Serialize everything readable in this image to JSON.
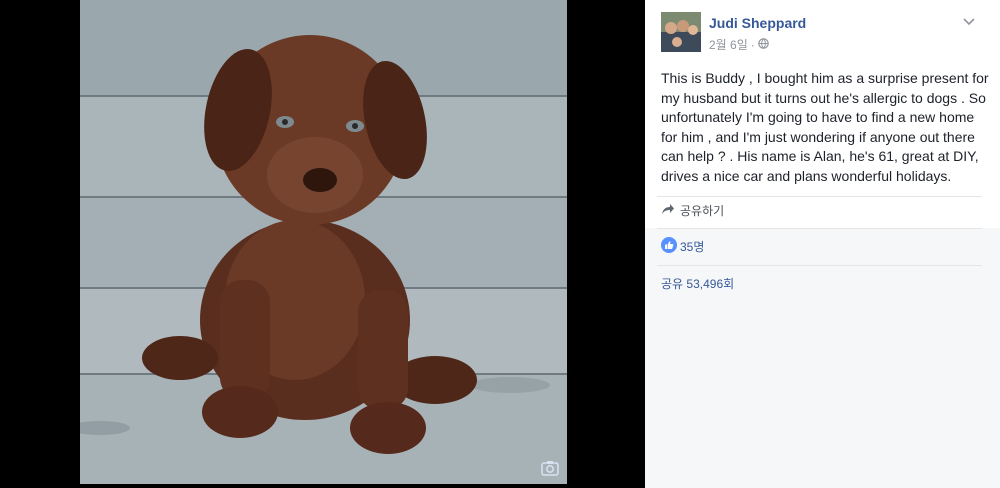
{
  "post": {
    "author": "Judi Sheppard",
    "timestamp": "2월 6일",
    "text": "This is Buddy , I bought him as a surprise present for my husband but it turns out he's allergic to dogs . So unfortunately I'm going to have to find a new home for him , and I'm just wondering if anyone out there can help ? . His name is Alan, he's 61, great at DIY, drives a nice car and plans wonderful holidays.",
    "share_label": "공유하기",
    "likes_count": "35명",
    "shares_count": "공유 53,496회"
  },
  "icons": {
    "camera": "camera-icon",
    "globe": "globe-icon",
    "chevron": "chevron-down-icon",
    "share": "share-arrow-icon",
    "like": "like-thumb-icon"
  },
  "colors": {
    "link": "#365899",
    "like_badge": "#5890ff",
    "panel_bg": "#ffffff",
    "footer_bg": "#f6f7f9"
  }
}
